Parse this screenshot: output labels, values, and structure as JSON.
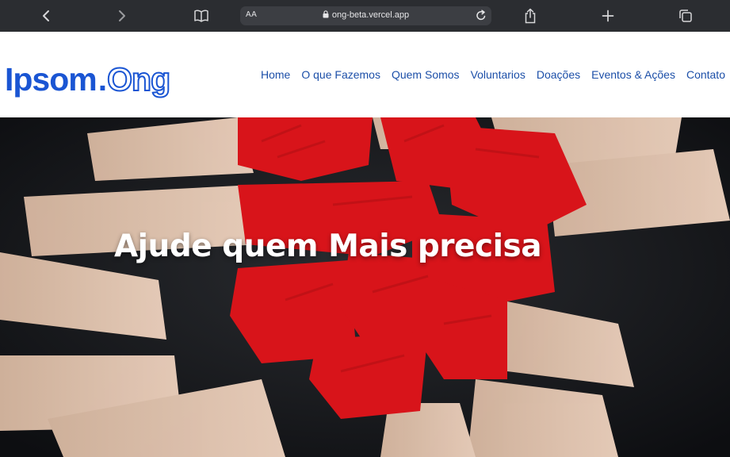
{
  "browser": {
    "text_size_label": "AA",
    "url": "ong-beta.vercel.app",
    "icons": [
      "back-icon",
      "forward-icon",
      "reader-book-icon",
      "lock-icon",
      "reload-icon",
      "share-icon",
      "new-tab-plus-icon",
      "tabs-icon"
    ]
  },
  "header": {
    "logo_main": "Ipsom",
    "logo_dot": ".",
    "logo_suffix": "Ong",
    "nav": [
      "Home",
      "O que Fazemos",
      "Quem Somos",
      "Voluntarios",
      "Doações",
      "Eventos & Ações",
      "Contato"
    ]
  },
  "hero": {
    "title": "Ajude quem Mais precisa"
  },
  "colors": {
    "brand_blue": "#1a55d3",
    "nav_blue": "#1c4fa8",
    "toolbar": "#2b2d31",
    "paint_red": "#d8141a"
  }
}
